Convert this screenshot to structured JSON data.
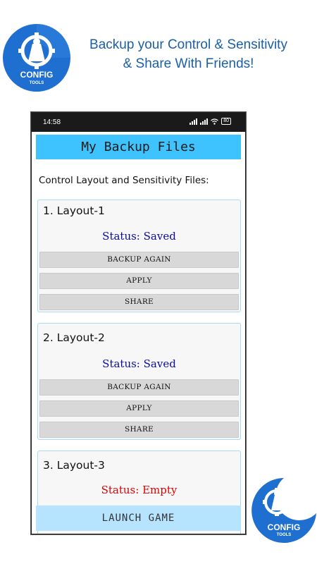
{
  "promo": {
    "line1": "Backup your Control & Sensitivity",
    "line2": "& Share With Friends!",
    "logo_text_top": "CONFIG",
    "logo_text_bottom": "TOOLS"
  },
  "status_bar": {
    "time": "14:58",
    "battery": "80",
    "icons": [
      "signal-icon",
      "signal-icon",
      "wifi-icon",
      "battery-icon"
    ]
  },
  "app": {
    "title": "My Backup Files",
    "section_title": "Control Layout and Sensitivity Files:",
    "launch_label": "LAUNCH GAME"
  },
  "layouts": [
    {
      "title": "1. Layout-1",
      "status": "Status: Saved",
      "buttons": [
        "BACKUP AGAIN",
        "APPLY",
        "SHARE"
      ]
    },
    {
      "title": "2. Layout-2",
      "status": "Status: Saved",
      "buttons": [
        "BACKUP AGAIN",
        "APPLY",
        "SHARE"
      ]
    },
    {
      "title": "3. Layout-3",
      "status": "Status: Empty",
      "buttons": []
    }
  ],
  "colors": {
    "promo_text": "#1b5fa8",
    "appbar": "#3ec3ff",
    "launch_bar": "#b6e4ff",
    "status_saved": "#0a0aa8",
    "status_empty": "#e00000",
    "logo_blue": "#1e6fd0"
  }
}
